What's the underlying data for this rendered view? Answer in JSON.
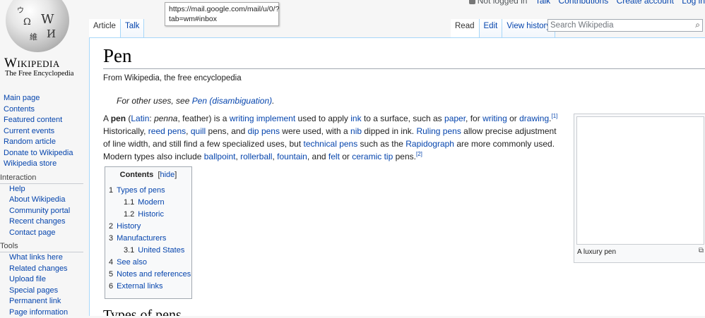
{
  "tooltip": {
    "line1": "https://mail.google.com/mail/u/0/?",
    "line2": "tab=wm#inbox"
  },
  "personal": {
    "not_logged_in": "Not logged in",
    "talk": "Talk",
    "contributions": "Contributions",
    "create_account": "Create account",
    "log_in": "Log in"
  },
  "logo": {
    "wordmark": "Wikipedia",
    "tagline": "The Free Encyclopedia",
    "glyphs": [
      "Ω",
      "W",
      "И",
      "維",
      "ウ"
    ]
  },
  "sidebar": {
    "main": [
      "Main page",
      "Contents",
      "Featured content",
      "Current events",
      "Random article",
      "Donate to Wikipedia",
      "Wikipedia store"
    ],
    "interaction": {
      "heading": "Interaction",
      "items": [
        "Help",
        "About Wikipedia",
        "Community portal",
        "Recent changes",
        "Contact page"
      ]
    },
    "tools": {
      "heading": "Tools",
      "items": [
        "What links here",
        "Related changes",
        "Upload file",
        "Special pages",
        "Permanent link",
        "Page information"
      ]
    }
  },
  "tabs": {
    "article": "Article",
    "talk": "Talk",
    "read": "Read",
    "edit": "Edit",
    "history": "View history"
  },
  "search": {
    "placeholder": "Search Wikipedia",
    "icon": "magnifier-icon"
  },
  "article": {
    "title": "Pen",
    "sitesub": "From Wikipedia, the free encyclopedia",
    "hatnote_prefix": "For other uses, see ",
    "hatnote_link": "Pen (disambiguation)",
    "hatnote_suffix": ".",
    "p": {
      "t1": "A ",
      "pen": "pen",
      "t2": " (",
      "latin": "Latin",
      "t3": ": ",
      "penna": "penna",
      "t4": ", feather) is a ",
      "writing_implement": "writing implement",
      "t5": " used to apply ",
      "ink": "ink",
      "t6": " to a surface, such as ",
      "paper": "paper",
      "t7": ", for ",
      "writing": "writing",
      "t8": " or ",
      "drawing": "drawing",
      "t9": ".",
      "ref1": "[1]",
      "t10": " Historically, ",
      "reed_pens": "reed pens",
      "t11": ", ",
      "quill": "quill",
      "t12": " pens, and ",
      "dip_pens": "dip pens",
      "t13": " were used, with a ",
      "nib": "nib",
      "t14": " dipped in ink. ",
      "ruling_pens": "Ruling pens",
      "t15": " allow precise adjustment of line width, and still find a few specialized uses, but ",
      "technical_pens": "technical pens",
      "t16": " such as the ",
      "rapidograph": "Rapidograph",
      "t17": " are more commonly used. Modern types also include ",
      "ballpoint": "ballpoint",
      "t18": ", ",
      "rollerball": "rollerball",
      "t19": ", ",
      "fountain": "fountain",
      "t20": ", and ",
      "felt": "felt",
      "t21": " or ",
      "ceramic_tip": "ceramic tip",
      "t22": " pens.",
      "ref2": "[2]"
    },
    "next_heading": "Types of pens"
  },
  "toc": {
    "title": "Contents",
    "hide": "hide",
    "items": [
      {
        "num": "1",
        "label": "Types of pens"
      },
      {
        "num": "1.1",
        "label": "Modern"
      },
      {
        "num": "1.2",
        "label": "Historic"
      },
      {
        "num": "2",
        "label": "History"
      },
      {
        "num": "3",
        "label": "Manufacturers"
      },
      {
        "num": "3.1",
        "label": "United States"
      },
      {
        "num": "4",
        "label": "See also"
      },
      {
        "num": "5",
        "label": "Notes and references"
      },
      {
        "num": "6",
        "label": "External links"
      }
    ]
  },
  "thumb": {
    "caption": "A luxury pen"
  },
  "colors": {
    "link": "#0645ad",
    "border": "#a7d7f9",
    "background": "#f6f6f6"
  }
}
